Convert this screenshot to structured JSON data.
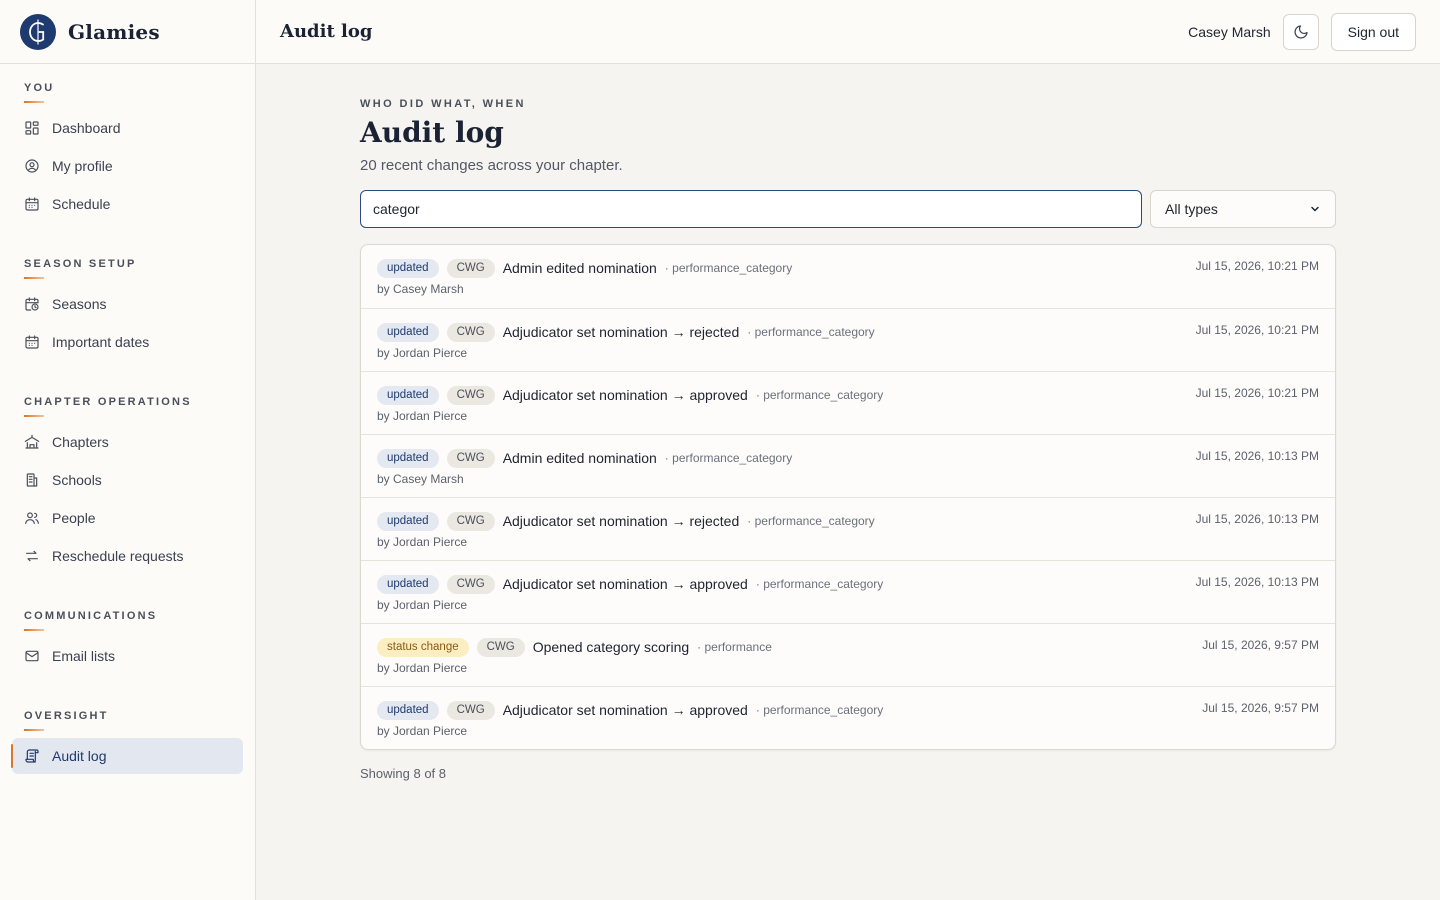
{
  "brand": {
    "name": "Glamies"
  },
  "sidebar": {
    "sections": [
      {
        "title": "YOU",
        "items": [
          {
            "label": "Dashboard",
            "icon": "dashboard-icon"
          },
          {
            "label": "My profile",
            "icon": "user-circle-icon"
          },
          {
            "label": "Schedule",
            "icon": "calendar-icon"
          }
        ]
      },
      {
        "title": "SEASON SETUP",
        "items": [
          {
            "label": "Seasons",
            "icon": "calendar-clock-icon"
          },
          {
            "label": "Important dates",
            "icon": "calendar-icon"
          }
        ]
      },
      {
        "title": "CHAPTER OPERATIONS",
        "items": [
          {
            "label": "Chapters",
            "icon": "chapters-icon"
          },
          {
            "label": "Schools",
            "icon": "school-icon"
          },
          {
            "label": "People",
            "icon": "people-icon"
          },
          {
            "label": "Reschedule requests",
            "icon": "swap-icon"
          }
        ]
      },
      {
        "title": "COMMUNICATIONS",
        "items": [
          {
            "label": "Email lists",
            "icon": "mail-icon"
          }
        ]
      },
      {
        "title": "OVERSIGHT",
        "items": [
          {
            "label": "Audit log",
            "icon": "scroll-icon",
            "active": true
          }
        ]
      }
    ]
  },
  "topbar": {
    "title": "Audit log",
    "user_name": "Casey Marsh",
    "signout_label": "Sign out"
  },
  "page": {
    "eyebrow": "WHO DID WHAT, WHEN",
    "title": "Audit log",
    "subtitle": "20 recent changes across your chapter."
  },
  "filters": {
    "search_value": "categor",
    "type_selected": "All types"
  },
  "log": [
    {
      "badge": "updated",
      "badge_kind": "updated",
      "chapter": "CWG",
      "action": "Admin edited nomination",
      "entity": "performance_category",
      "actor": "by Casey Marsh",
      "time": "Jul 15, 2026, 10:21 PM"
    },
    {
      "badge": "updated",
      "badge_kind": "updated",
      "chapter": "CWG",
      "action": "Adjudicator set nomination → rejected",
      "entity": "performance_category",
      "actor": "by Jordan Pierce",
      "time": "Jul 15, 2026, 10:21 PM"
    },
    {
      "badge": "updated",
      "badge_kind": "updated",
      "chapter": "CWG",
      "action": "Adjudicator set nomination → approved",
      "entity": "performance_category",
      "actor": "by Jordan Pierce",
      "time": "Jul 15, 2026, 10:21 PM"
    },
    {
      "badge": "updated",
      "badge_kind": "updated",
      "chapter": "CWG",
      "action": "Admin edited nomination",
      "entity": "performance_category",
      "actor": "by Casey Marsh",
      "time": "Jul 15, 2026, 10:13 PM"
    },
    {
      "badge": "updated",
      "badge_kind": "updated",
      "chapter": "CWG",
      "action": "Adjudicator set nomination → rejected",
      "entity": "performance_category",
      "actor": "by Jordan Pierce",
      "time": "Jul 15, 2026, 10:13 PM"
    },
    {
      "badge": "updated",
      "badge_kind": "updated",
      "chapter": "CWG",
      "action": "Adjudicator set nomination → approved",
      "entity": "performance_category",
      "actor": "by Jordan Pierce",
      "time": "Jul 15, 2026, 10:13 PM"
    },
    {
      "badge": "status change",
      "badge_kind": "status",
      "chapter": "CWG",
      "action": "Opened category scoring",
      "entity": "performance",
      "actor": "by Jordan Pierce",
      "time": "Jul 15, 2026, 9:57 PM"
    },
    {
      "badge": "updated",
      "badge_kind": "updated",
      "chapter": "CWG",
      "action": "Adjudicator set nomination → approved",
      "entity": "performance_category",
      "actor": "by Jordan Pierce",
      "time": "Jul 15, 2026, 9:57 PM"
    }
  ],
  "footer": {
    "count_text": "Showing 8 of 8"
  },
  "colors": {
    "brand_navy": "#1e3a6e",
    "accent_orange": "#d9772b"
  }
}
